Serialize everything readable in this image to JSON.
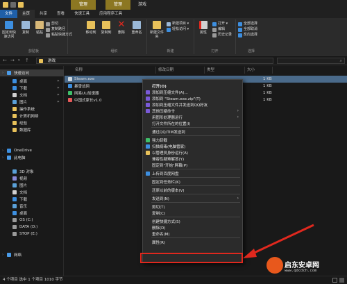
{
  "window": {
    "title": "游戏",
    "context_tab_manage_1": "管理",
    "context_tab_manage_2": "管理"
  },
  "ribbon_tabs": [
    "文件",
    "主页",
    "共享",
    "查看",
    "快速工具",
    "应用程序工具"
  ],
  "ribbon": {
    "clipboard": {
      "label": "剪贴板",
      "pin_quick": "固定到快速访问",
      "copy": "复制",
      "paste": "粘贴",
      "cut": "剪切",
      "copy_path": "复制路径",
      "paste_shortcut": "粘贴快捷方式"
    },
    "organize": {
      "label": "组织",
      "move_to": "移动到",
      "copy_to": "复制到",
      "delete": "删除",
      "rename": "重命名"
    },
    "new": {
      "label": "新建",
      "new_folder": "新建文件夹",
      "new_item": "新建项目 ▾",
      "easy_access": "轻松访问 ▾"
    },
    "open": {
      "label": "打开",
      "properties": "属性",
      "open": "打开 ▾",
      "edit": "编辑",
      "history": "历史记录"
    },
    "select": {
      "label": "选择",
      "select_all": "全部选择",
      "select_none": "全部取消",
      "invert": "反向选择"
    }
  },
  "address": {
    "path": "游戏"
  },
  "nav": [
    {
      "label": "快速访问",
      "icon": "star-icon",
      "color": "#4a9be8",
      "indent": 0,
      "sel": true
    },
    {
      "label": "桌面",
      "icon": "desktop-icon",
      "color": "#3d8fe0",
      "indent": 1,
      "pin": true
    },
    {
      "label": "下载",
      "icon": "download-icon",
      "color": "#3d8fe0",
      "indent": 1,
      "pin": true
    },
    {
      "label": "文档",
      "icon": "document-icon",
      "color": "#d0d0d0",
      "indent": 1,
      "pin": true
    },
    {
      "label": "图片",
      "icon": "picture-icon",
      "color": "#5aa0d8",
      "indent": 1,
      "pin": true
    },
    {
      "label": "操作系统",
      "icon": "folder-icon",
      "color": "#e8c15a",
      "indent": 1
    },
    {
      "label": "计算机网络",
      "icon": "folder-icon",
      "color": "#e8c15a",
      "indent": 1
    },
    {
      "label": "经验",
      "icon": "folder-icon",
      "color": "#e8c15a",
      "indent": 1
    },
    {
      "label": "数据库",
      "icon": "folder-icon",
      "color": "#e8c15a",
      "indent": 1
    },
    {
      "label": "OneDrive",
      "icon": "cloud-icon",
      "color": "#3d8fe0",
      "indent": 0
    },
    {
      "label": "此电脑",
      "icon": "computer-icon",
      "color": "#4a9be8",
      "indent": 0
    },
    {
      "label": "3D 对象",
      "icon": "cube-icon",
      "color": "#5aa0d8",
      "indent": 1
    },
    {
      "label": "视频",
      "icon": "video-icon",
      "color": "#8a8ad8",
      "indent": 1
    },
    {
      "label": "图片",
      "icon": "picture-icon",
      "color": "#5aa0d8",
      "indent": 1
    },
    {
      "label": "文档",
      "icon": "document-icon",
      "color": "#d0d0d0",
      "indent": 1
    },
    {
      "label": "下载",
      "icon": "download-icon",
      "color": "#3d8fe0",
      "indent": 1
    },
    {
      "label": "音乐",
      "icon": "music-icon",
      "color": "#5aa0d8",
      "indent": 1
    },
    {
      "label": "桌面",
      "icon": "desktop-icon",
      "color": "#3d8fe0",
      "indent": 1
    },
    {
      "label": "OS (C:)",
      "icon": "drive-icon",
      "color": "#9a9a9a",
      "indent": 1
    },
    {
      "label": "DATA (D:)",
      "icon": "drive-icon",
      "color": "#9a9a9a",
      "indent": 1
    },
    {
      "label": "STOP (E:)",
      "icon": "drive-icon",
      "color": "#9a9a9a",
      "indent": 1
    },
    {
      "label": "网络",
      "icon": "network-icon",
      "color": "#4a9be8",
      "indent": 0
    }
  ],
  "columns": {
    "name": "名称",
    "date": "修改日期",
    "type": "类型",
    "size": "大小"
  },
  "files": [
    {
      "name": "Steam.exe",
      "size": "1 KB",
      "icon": "steam-icon",
      "color": "#cfd8e0",
      "sel": true
    },
    {
      "name": "暴雪战网",
      "size": "1 KB",
      "icon": "battlenet-icon",
      "color": "#3d8fe0"
    },
    {
      "name": "网易UU加速器",
      "size": "1 KB",
      "icon": "uu-icon",
      "color": "#3fbf6a"
    },
    {
      "name": "中国式家长v1.0",
      "size": "1 KB",
      "icon": "game-icon",
      "color": "#e85a5a"
    }
  ],
  "status": "4 个项目   选中 1 个项目  1010 字节",
  "context_menu": [
    {
      "label": "打开(O)",
      "bold": true
    },
    {
      "label": "添加到压缩文件(A)...",
      "icon": "archive-icon",
      "color": "#7a5ad8"
    },
    {
      "label": "添加到 \"Steam.exe.zip\"(T)",
      "icon": "archive-icon",
      "color": "#7a5ad8"
    },
    {
      "label": "添加到压缩文件并发送到QQ好友",
      "icon": "archive-icon",
      "color": "#7a5ad8"
    },
    {
      "label": "其他压缩命令",
      "icon": "archive-icon",
      "color": "#7a5ad8",
      "sub": true
    },
    {
      "label": "用图形处理器运行",
      "sub": true
    },
    {
      "label": "打开文件所在的位置(I)"
    },
    {
      "sep": true
    },
    {
      "label": "通过QQ/TIM发送到"
    },
    {
      "sep": true
    },
    {
      "label": "强力卸载",
      "icon": "uninstall-icon",
      "color": "#3fbf6a"
    },
    {
      "label": "扫描病毒(电脑管家)",
      "icon": "shield-icon",
      "color": "#3d8fe0"
    },
    {
      "label": "以管理员身份运行(A)",
      "icon": "admin-shield-icon",
      "color": "#e8c15a"
    },
    {
      "label": "兼容性疑难解答(Y)"
    },
    {
      "label": "固定到\"开始\"屏幕(P)"
    },
    {
      "sep": true
    },
    {
      "label": "上传到百度网盘",
      "icon": "baidu-icon",
      "color": "#3d8fe0"
    },
    {
      "sep": true
    },
    {
      "label": "固定到任务栏(K)"
    },
    {
      "sep": true
    },
    {
      "label": "还原以前的版本(V)"
    },
    {
      "sep": true
    },
    {
      "label": "发送到(N)",
      "sub": true
    },
    {
      "sep": true
    },
    {
      "label": "剪切(T)"
    },
    {
      "label": "复制(C)"
    },
    {
      "sep": true
    },
    {
      "label": "创建快捷方式(S)"
    },
    {
      "label": "删除(D)"
    },
    {
      "label": "重命名(M)"
    },
    {
      "sep": true
    },
    {
      "label": "属性(R)"
    }
  ],
  "watermark": {
    "title": "启东安卓网",
    "url": "www.qdcdch.com"
  }
}
